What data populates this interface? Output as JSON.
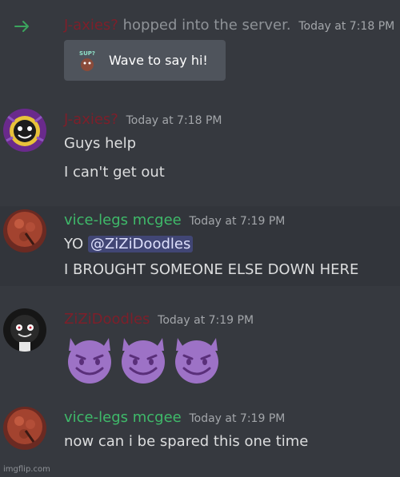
{
  "join": {
    "username": "J-axies?",
    "text": "hopped into the server.",
    "timestamp": "Today at 7:18 PM",
    "wave_label": "Wave to say hi!",
    "sticker_text": "SUP?"
  },
  "messages": [
    {
      "username": "J-axies?",
      "timestamp": "Today at 7:18 PM",
      "lines": [
        "Guys help",
        "I can't get out"
      ]
    },
    {
      "username": "vice-legs mcgee",
      "timestamp": "Today at 7:19 PM",
      "line1_prefix": "YO ",
      "mention": "@ZiZiDoodles",
      "line2": "I BROUGHT SOMEONE ELSE DOWN HERE"
    },
    {
      "username": "ZiZiDoodles",
      "timestamp": "Today at 7:19 PM",
      "emoji_count": 3,
      "emoji_name": "smiling-imp"
    },
    {
      "username": "vice-legs mcgee",
      "timestamp": "Today at 7:19 PM",
      "lines": [
        "now can i be spared this one time"
      ]
    }
  ],
  "colors": {
    "background": "#36393f",
    "red_username": "#7d1f2a",
    "green_username": "#3fba6a",
    "join_arrow": "#3ba55d",
    "mention_bg": "#414675",
    "emoji_purple": "#9d72c6"
  },
  "watermark": "imgflip.com"
}
